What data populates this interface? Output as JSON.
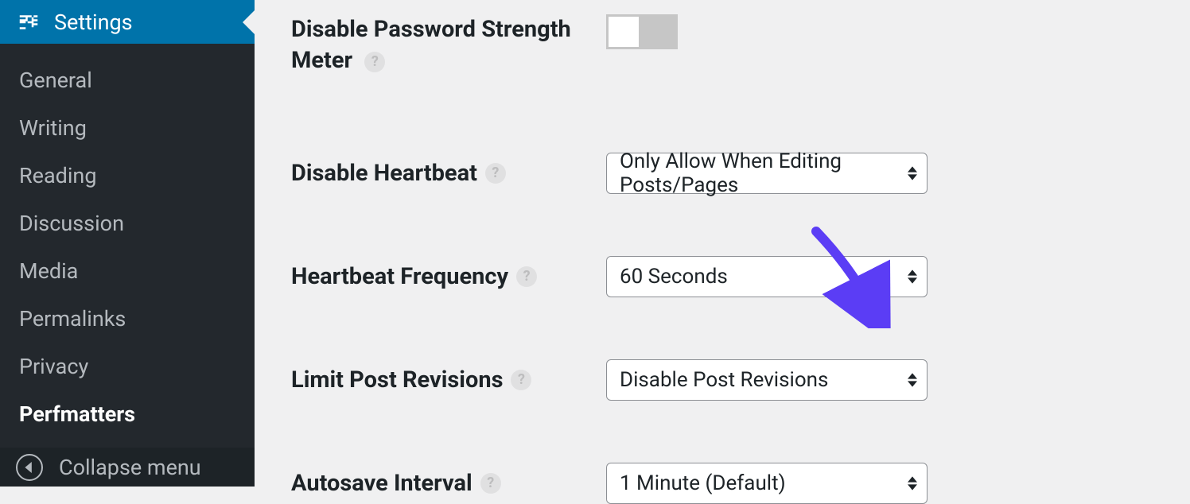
{
  "sidebar": {
    "active": {
      "label": "Settings"
    },
    "items": [
      {
        "label": "General"
      },
      {
        "label": "Writing"
      },
      {
        "label": "Reading"
      },
      {
        "label": "Discussion"
      },
      {
        "label": "Media"
      },
      {
        "label": "Permalinks"
      },
      {
        "label": "Privacy"
      },
      {
        "label": "Perfmatters"
      }
    ],
    "collapse_label": "Collapse menu"
  },
  "settings": {
    "password_meter": {
      "label_line1": "Disable Password Strength",
      "label_line2": "Meter"
    },
    "disable_heartbeat": {
      "label": "Disable Heartbeat",
      "value": "Only Allow When Editing Posts/Pages"
    },
    "heartbeat_frequency": {
      "label": "Heartbeat Frequency",
      "value": "60 Seconds"
    },
    "limit_revisions": {
      "label": "Limit Post Revisions",
      "value": "Disable Post Revisions"
    },
    "autosave_interval": {
      "label": "Autosave Interval",
      "value": "1 Minute (Default)"
    }
  },
  "help_glyph": "?",
  "annotation": {
    "color": "#5b3df5"
  }
}
